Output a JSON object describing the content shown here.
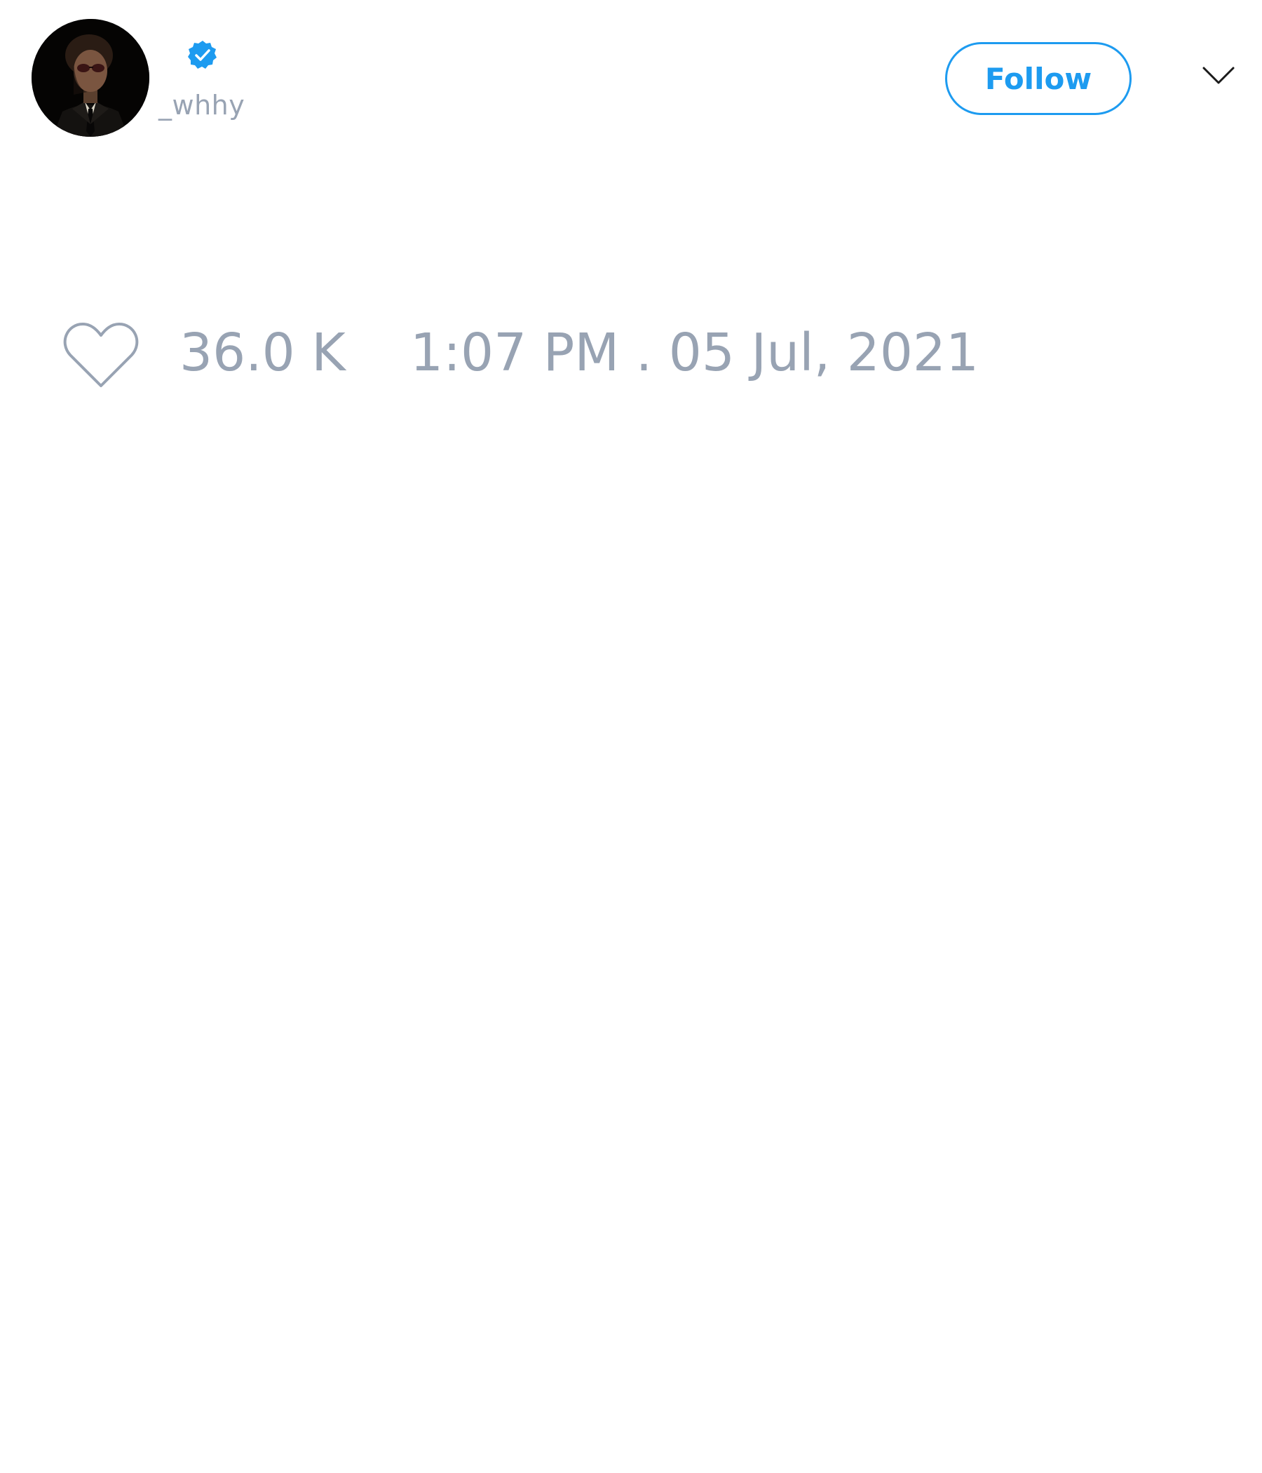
{
  "user": {
    "handle": "_whhy",
    "verified": true,
    "avatar_icon": "profile-photo"
  },
  "actions": {
    "follow_label": "Follow",
    "menu_icon": "chevron-down-icon"
  },
  "stats": {
    "like_icon": "heart-icon",
    "likes": "36.0 K",
    "timestamp": "1:07 PM . 05 Jul, 2021"
  },
  "colors": {
    "accent": "#1d9bf0",
    "muted_text": "#98a3b3",
    "background": "#ffffff"
  }
}
